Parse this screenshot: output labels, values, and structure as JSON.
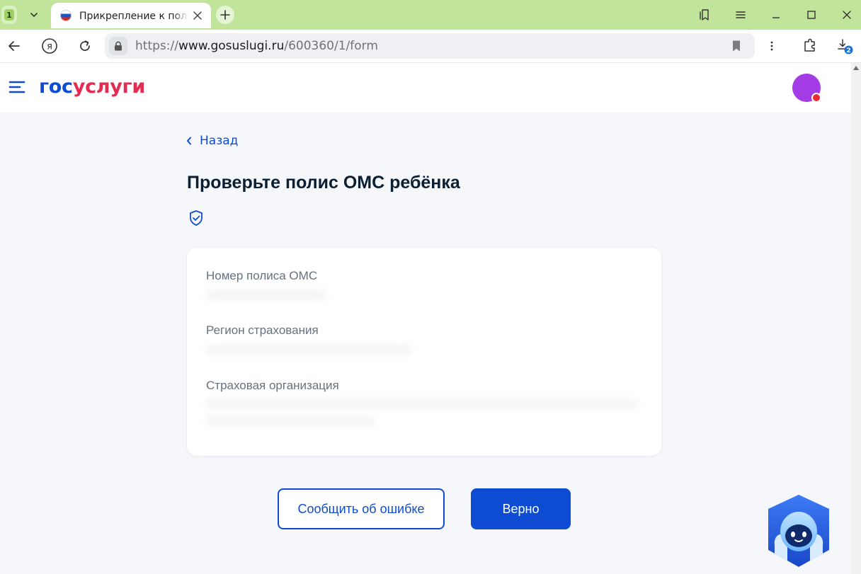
{
  "browser": {
    "tab_count": "1",
    "tab_title": "Прикрепление к поликлинике",
    "url_protocol": "https://",
    "url_host": "www.gosuslugi.ru",
    "url_path": "/600360/1/form",
    "downloads_badge": "2"
  },
  "header": {
    "logo_part1": "гос",
    "logo_part2": "услуги",
    "logo_color_primary": "#0d4cd3",
    "logo_color_accent": "#e52b50",
    "avatar_color": "#a43ce6"
  },
  "page": {
    "back_label": "Назад",
    "title": "Проверьте полис ОМС ребёнка",
    "fields": [
      {
        "label": "Номер полиса ОМС"
      },
      {
        "label": "Регион страхования"
      },
      {
        "label": "Страховая организация"
      }
    ],
    "report_error_label": "Сообщить об ошибке",
    "confirm_label": "Верно"
  },
  "icons": [
    "burger-menu-icon",
    "shield-check-icon",
    "chevron-left-icon",
    "assistant-robot-icon"
  ]
}
